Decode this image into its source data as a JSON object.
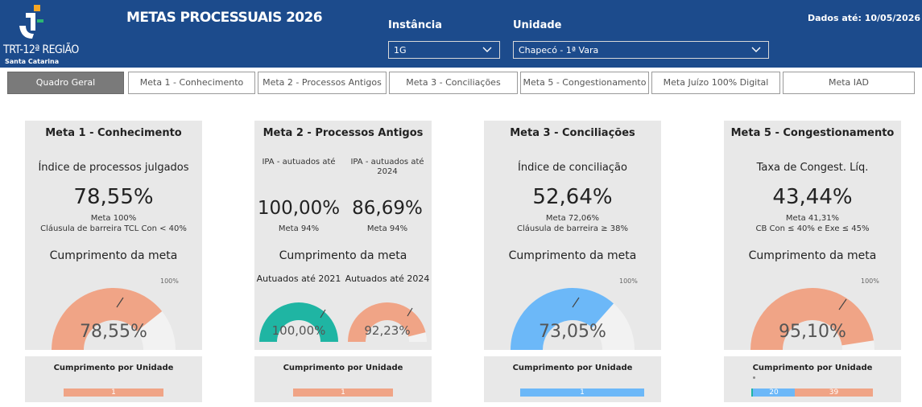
{
  "header": {
    "logo_text": "TRT-12ª REGIÃO",
    "logo_sub": "Santa Catarina",
    "title": "METAS PROCESSUAIS 2026",
    "instancia_label": "Instância",
    "instancia_value": "1G",
    "unidade_label": "Unidade",
    "unidade_value": "Chapecó - 1ª Vara",
    "data_ate": "Dados até: 10/05/2026",
    "brand_color": "#1c4b8c"
  },
  "tabs": [
    "Quadro Geral",
    "Meta 1 - Conhecimento",
    "Meta 2 - Processos Antigos",
    "Meta 3 - Conciliações",
    "Meta 5 - Congestionamento",
    "Meta Juízo 100% Digital",
    "Meta IAD"
  ],
  "cards": {
    "meta1": {
      "title": "Meta 1 - Conhecimento",
      "subtitle": "Índice de processos julgados",
      "value": "78,55%",
      "meta": "Meta 100%",
      "meta2": "Cláusula de barreira TCL Con < 40%",
      "cump": "Cumprimento da meta",
      "gauge_value": "78,55%",
      "gauge_fraction": 0.7855,
      "gauge_target": "100%",
      "color": "#f0a486"
    },
    "meta2": {
      "title": "Meta 2 - Processos Antigos",
      "left_label": "IPA - autuados até",
      "right_label_1": "IPA - autuados até",
      "right_label_2": "2024",
      "left_value": "100,00%",
      "right_value": "86,69%",
      "left_meta": "Meta 94%",
      "right_meta": "Meta 94%",
      "cump": "Cumprimento da meta",
      "g1_label": "Autuados até 2021",
      "g2_label": "Autuados até 2024",
      "g1_value": "100,00%",
      "g2_value": "92,23%",
      "g1_fraction": 1.0,
      "g2_fraction": 0.9223,
      "g1_color": "#1fb5a3",
      "g2_color": "#f0a486"
    },
    "meta3": {
      "title": "Meta 3 - Conciliações",
      "subtitle": "Índice de conciliação",
      "value": "52,64%",
      "meta": "Meta 72,06%",
      "meta2": "Cláusula de barreira ≥ 38%",
      "cump": "Cumprimento da meta",
      "gauge_value": "73,05%",
      "gauge_fraction": 0.7305,
      "gauge_target": "100%",
      "color": "#6cb8f8"
    },
    "meta5": {
      "title": "Meta 5 - Congestionamento",
      "subtitle": "Taxa de Congest. Líq.",
      "value": "43,44%",
      "meta": "Meta 41,31%",
      "meta2": "CB Con ≤ 40% e Exe ≤ 45%",
      "cump": "Cumprimento da meta",
      "gauge_value": "95,10%",
      "gauge_fraction": 0.951,
      "gauge_target": "100%",
      "color": "#f0a486"
    }
  },
  "units": {
    "title": "Cumprimento por Unidade",
    "meta1_bar": "1",
    "meta2_bar": "1",
    "meta3_bar": "1",
    "meta5_bar_a": "20",
    "meta5_bar_b": "39"
  }
}
